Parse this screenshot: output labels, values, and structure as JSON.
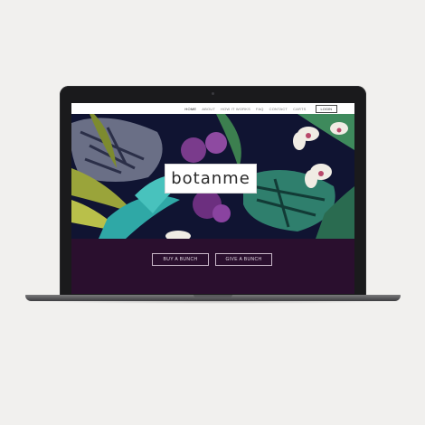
{
  "nav": {
    "links": [
      "HOME",
      "ABOUT",
      "HOW IT WORKS",
      "FAQ",
      "CONTACT",
      "CARTS"
    ],
    "login_label": "LOGIN"
  },
  "hero": {
    "logo": "botanme"
  },
  "cta": {
    "buy_label": "BUY A BUNCH",
    "give_label": "GIVE A BUNCH"
  },
  "colors": {
    "page_bg": "#f1f0ee",
    "cta_band": "#2a0f2e",
    "hero_bg": "#0f1230"
  }
}
